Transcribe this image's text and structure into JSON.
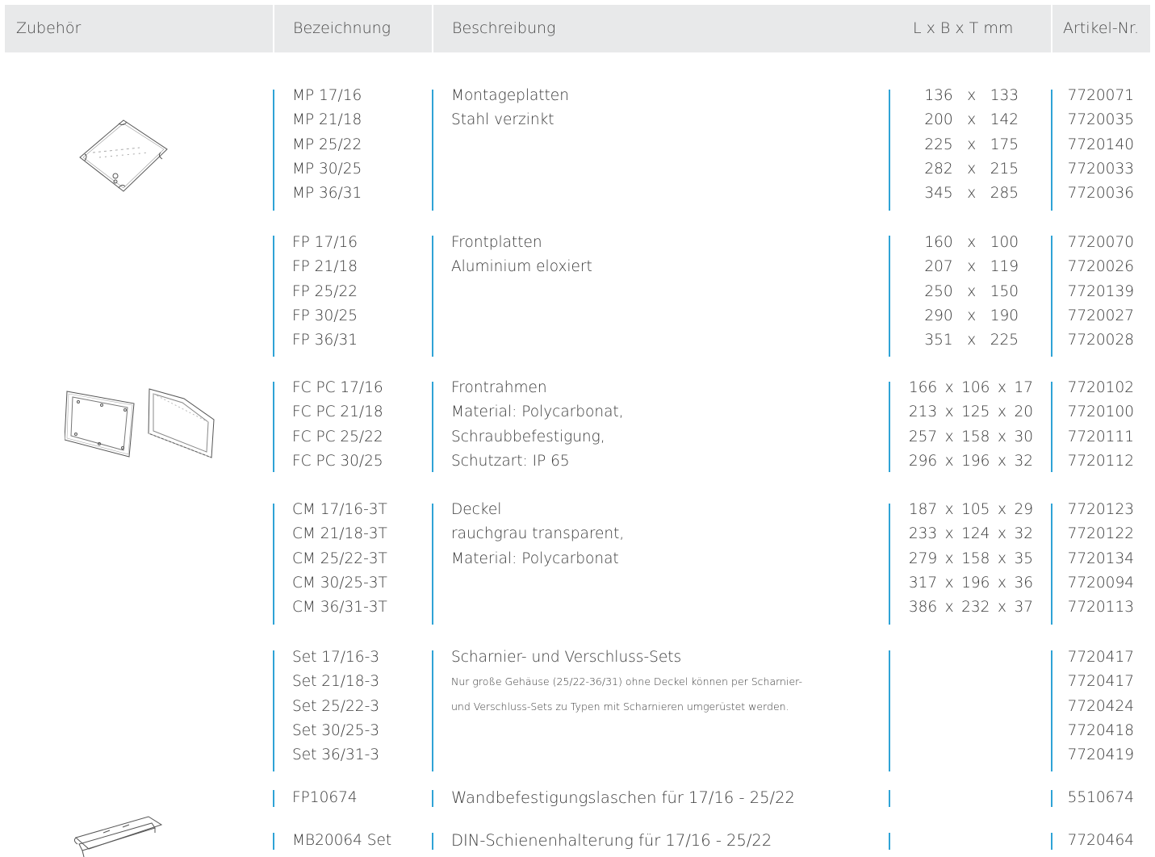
{
  "header": {
    "zubehoer": "Zubehör",
    "bezeichnung": "Bezeichnung",
    "beschreibung": "Beschreibung",
    "masse": "L  x  B  x  T  mm",
    "artikel": "Artikel-Nr."
  },
  "groups": [
    {
      "names": [
        "MP 17/16",
        "MP 21/18",
        "MP 25/22",
        "MP 30/25",
        "MP 36/31"
      ],
      "description": [
        "Montageplatten",
        "Stahl verzinkt"
      ],
      "dims": [
        [
          "136",
          "133"
        ],
        [
          "200",
          "142"
        ],
        [
          "225",
          "175"
        ],
        [
          "282",
          "215"
        ],
        [
          "345",
          "285"
        ]
      ],
      "articles": [
        "7720071",
        "7720035",
        "7720140",
        "7720033",
        "7720036"
      ]
    },
    {
      "names": [
        "FP 17/16",
        "FP 21/18",
        "FP 25/22",
        "FP 30/25",
        "FP 36/31"
      ],
      "description": [
        "Frontplatten",
        "Aluminium eloxiert"
      ],
      "dims": [
        [
          "160",
          "100"
        ],
        [
          "207",
          "119"
        ],
        [
          "250",
          "150"
        ],
        [
          "290",
          "190"
        ],
        [
          "351",
          "225"
        ]
      ],
      "articles": [
        "7720070",
        "7720026",
        "7720139",
        "7720027",
        "7720028"
      ]
    },
    {
      "names": [
        "FC PC 17/16",
        "FC PC 21/18",
        "FC PC 25/22",
        "FC PC 30/25"
      ],
      "description": [
        "Frontrahmen",
        "Material: Polycarbonat,",
        "Schraubbefestigung,",
        "Schutzart: IP 65"
      ],
      "dims": [
        [
          "166",
          "106",
          "17"
        ],
        [
          "213",
          "125",
          "20"
        ],
        [
          "257",
          "158",
          "30"
        ],
        [
          "296",
          "196",
          "32"
        ]
      ],
      "articles": [
        "7720102",
        "7720100",
        "7720111",
        "7720112"
      ]
    },
    {
      "names": [
        "CM 17/16-3T",
        "CM 21/18-3T",
        "CM 25/22-3T",
        "CM 30/25-3T",
        "CM 36/31-3T"
      ],
      "description": [
        "Deckel",
        "rauchgrau transparent,",
        "Material: Polycarbonat"
      ],
      "dims": [
        [
          "187",
          "105",
          "29"
        ],
        [
          "233",
          "124",
          "32"
        ],
        [
          "279",
          "158",
          "35"
        ],
        [
          "317",
          "196",
          "36"
        ],
        [
          "386",
          "232",
          "37"
        ]
      ],
      "articles": [
        "7720123",
        "7720122",
        "7720134",
        "7720094",
        "7720113"
      ]
    },
    {
      "names": [
        "Set 17/16-3",
        "Set 21/18-3",
        "Set 25/22-3",
        "Set 30/25-3",
        "Set 36/31-3"
      ],
      "description_title": "Scharnier- und Verschluss-Sets",
      "description_small": [
        "Nur große Gehäuse (25/22-36/31) ohne Deckel können per Scharnier-",
        "und Verschluss-Sets zu Typen mit Scharnieren umgerüstet werden."
      ],
      "articles": [
        "7720417",
        "7720417",
        "7720424",
        "7720418",
        "7720419"
      ]
    },
    {
      "names": [
        "FP10674"
      ],
      "description": [
        "Wandbefestigungslaschen für 17/16 - 25/22"
      ],
      "articles": [
        "5510674"
      ]
    },
    {
      "names": [
        "MB20064 Set"
      ],
      "description": [
        "DIN-Schienenhalterung für 17/16 - 25/22"
      ],
      "articles": [
        "7720464"
      ]
    }
  ],
  "dim_separator": "x",
  "colors": {
    "accent": "#2fa3d6",
    "header_bg": "#e8e9ea",
    "text": "#3a3a3a"
  },
  "images": [
    "mounting-plate",
    "front-frame-pair",
    "din-rail-holder"
  ]
}
